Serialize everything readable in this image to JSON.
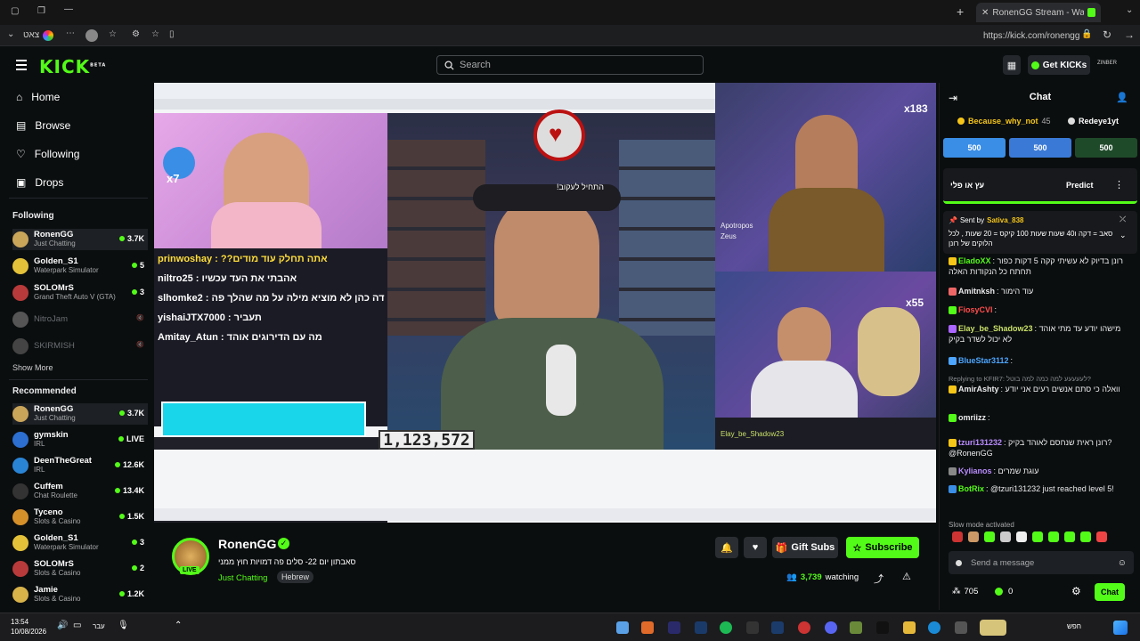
{
  "browser": {
    "tab_title": "RonenGG Stream - Watch Live",
    "url": "https://kick.com/ronengg",
    "profile_label": "צאט"
  },
  "nav": {
    "logo": "KICK",
    "logo_beta": "BETA",
    "search_placeholder": "Search",
    "get_kicks": "Get KICKs",
    "user": "ZINBER"
  },
  "sidebar": {
    "main_items": [
      {
        "label": "Home",
        "icon": "home-icon"
      },
      {
        "label": "Browse",
        "icon": "browse-icon"
      },
      {
        "label": "Following",
        "icon": "heart-icon"
      },
      {
        "label": "Drops",
        "icon": "drops-icon"
      }
    ],
    "following_title": "Following",
    "following": [
      {
        "name": "RonenGG",
        "category": "Just Chatting",
        "viewers": "3.7K",
        "color": "#c9a55a"
      },
      {
        "name": "Golden_S1",
        "category": "Waterpark Simulator",
        "viewers": "5",
        "color": "#e3c23a"
      },
      {
        "name": "SOLOMrS",
        "category": "Grand Theft Auto V (GTA)",
        "viewers": "3",
        "color": "#b83a3a"
      },
      {
        "name": "NitroJam",
        "category": "",
        "viewers": "",
        "color": "#555"
      },
      {
        "name": "SKIRMISH",
        "category": "",
        "viewers": "",
        "color": "#444"
      }
    ],
    "show_more": "Show More",
    "recommended_title": "Recommended",
    "recommended": [
      {
        "name": "RonenGG",
        "category": "Just Chatting",
        "viewers": "3.7K",
        "color": "#c9a55a"
      },
      {
        "name": "gymskin",
        "category": "IRL",
        "viewers": "LIVE",
        "color": "#2c6fd1"
      },
      {
        "name": "DeenTheGreat",
        "category": "IRL",
        "viewers": "12.6K",
        "color": "#2a84d6"
      },
      {
        "name": "Cuffem",
        "category": "Chat Roulette",
        "viewers": "13.4K",
        "color": "#333"
      },
      {
        "name": "Tyceno",
        "category": "Slots & Casino",
        "viewers": "1.5K",
        "color": "#d6902a"
      },
      {
        "name": "Golden_S1",
        "category": "Waterpark Simulator",
        "viewers": "3",
        "color": "#e3c23a"
      },
      {
        "name": "SOLOMrS",
        "category": "Slots & Casino",
        "viewers": "2",
        "color": "#b83a3a"
      },
      {
        "name": "Jamie",
        "category": "Slots & Casino",
        "viewers": "1.2K",
        "color": "#d8b34a"
      }
    ]
  },
  "player": {
    "counter": "1,123,572",
    "overlay_multiplier_1": "x7",
    "overlay_multiplier_2": "x183",
    "overlay_multiplier_3": "x55",
    "chat_lines": [
      "prinwoshay : ??אתה תחלק עוד מודים",
      "niltro25 : אהבתי את העד עכשיו",
      "slhomke2 : אוהד למה דה כהן לא מוציא מילה על מה שהלך פה",
      "yishaiJTX7000 : תעביר",
      "Amitay_Atun : מה עם הדירוגים אוהד"
    ],
    "top_text": "!התחיל לעקוב",
    "mini_user_1": "Apotropos",
    "mini_user_2": "Zeus",
    "mini_chat_bottom": "Elay_be_Shadow23"
  },
  "stream": {
    "streamer": "RonenGG",
    "title": "סאבתון יום 22- סלים פה דמויות חוץ ממני",
    "category": "Just Chatting",
    "tag": "Hebrew",
    "live": "LIVE",
    "gift_subs": "Gift Subs",
    "subscribe": "Subscribe",
    "viewers": "3,739",
    "watching": "watching"
  },
  "chat": {
    "title": "Chat",
    "top_gifters": [
      {
        "name": "Because_why_not",
        "count": "45"
      },
      {
        "name": "Redeye1yt",
        "count": ""
      }
    ],
    "kicks": [
      "500",
      "500",
      "500"
    ],
    "prediction_title": "עץ או פלי",
    "predict": "Predict",
    "pinned_sent_by": "Sent by",
    "pinned_user": "Sativa_838",
    "pinned_text": "סאב = דקה ו40 שעות שעות 100 קיקס = 20 שעות , לכל הלוקים של רונן",
    "messages": [
      {
        "user": "EladoXX",
        "text": ": רונן בדיוק לא עשיתי קקה 5 דקות כפור תחתח כל הנקודות האלה",
        "color": "#53fc18"
      },
      {
        "user": "Amitnksh",
        "text": ": עוד הימור",
        "color": "#e9eaeb"
      },
      {
        "user": "FiosyCVI",
        "text": ":",
        "color": "#ff4d4d"
      },
      {
        "user": "Elay_be_Shadow23",
        "text": ": מישהו יודע עד מתי אוהד לא יכול לשדר בקיק",
        "color": "#c9e06a"
      },
      {
        "user": "BlueStar3112",
        "text": ":",
        "color": "#4da6ff"
      },
      {
        "user": "AmirAshty",
        "text": ": וואלה כי סתם אנשים רעים אני יודע",
        "color": "#e9eaeb"
      },
      {
        "user": "omriizz",
        "text": ":",
        "color": "#e9eaeb"
      },
      {
        "user": "tzuri131232",
        "text": ": רונן ראית שנחסם לאוהד בקיק? @RonenGG",
        "color": "#b98cff"
      },
      {
        "user": "Kylianos",
        "text": ": עוגת שמרים",
        "color": "#b98cff"
      },
      {
        "user": "BotRix",
        "text": ": @tzuri131232 just reached level 5!",
        "color": "#53fc18"
      }
    ],
    "replying_to": "Replying to KFIR7: לעעעעע למה כמה למה בוטל?",
    "slow_mode": "Slow mode activated",
    "input_placeholder": "Send a message",
    "points": "705",
    "kicks_balance": "0",
    "chat_button": "Chat"
  },
  "taskbar": {
    "time": "13:54",
    "date": "10/08/2026",
    "lang": "עבר",
    "search_label": "חפש"
  }
}
